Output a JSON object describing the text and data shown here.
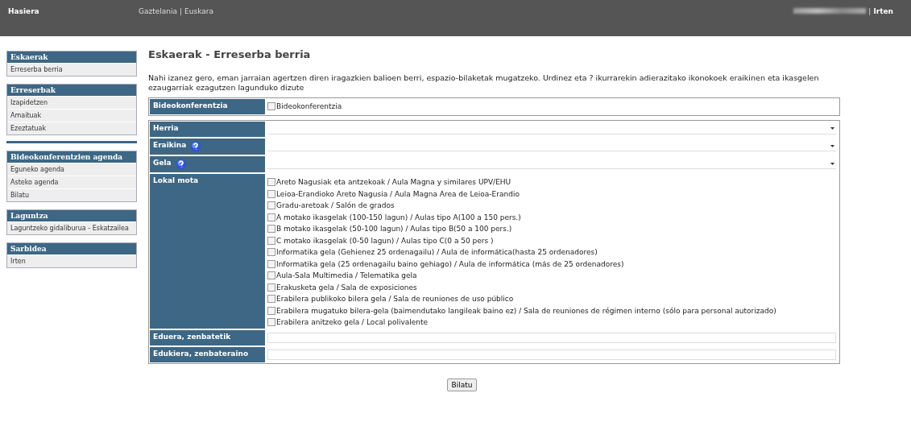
{
  "header": {
    "home": "Hasiera",
    "languages": [
      "Gaztelania",
      "Euskara"
    ],
    "separator": "|",
    "user_redacted": true,
    "logout": "Irten"
  },
  "sidebar": {
    "sections": [
      {
        "title": "Eskaerak",
        "items": [
          "Erreserba berria"
        ]
      },
      {
        "title": "Erreserbak",
        "items": [
          "Izapidetzen",
          "Amaituak",
          "Ezeztatuak"
        ],
        "divider_after": true
      },
      {
        "title": "Bideokonferentzien agenda",
        "items": [
          "Eguneko agenda",
          "Asteko agenda",
          "Bilatu"
        ]
      },
      {
        "title": "Laguntza",
        "items": [
          "Laguntzeko gidaliburua - Eskatzailea"
        ]
      },
      {
        "title": "Sarbidea",
        "items": [
          "Irten"
        ]
      }
    ]
  },
  "page_title": "Eskaerak - Erreserba berria",
  "description": "Nahi izanez gero, eman jarraian agertzen diren iragazkien balioen berri, espazio-bilaketak mugatzeko. Urdinez eta ? ikurrarekin adierazitako ikonokoek eraikinen eta ikasgelen ezaugarriak ezagutzen lagunduko dizute",
  "videoconference": {
    "label": "Bideokonferentzia",
    "option": {
      "label": "Bideokonferentzia",
      "checked": false
    }
  },
  "filters": [
    {
      "kind": "select",
      "label": "Herria",
      "help": false
    },
    {
      "kind": "select",
      "label": "Eraikina",
      "help": true
    },
    {
      "kind": "select",
      "label": "Gela",
      "help": true
    },
    {
      "kind": "checklist",
      "label": "Lokal mota",
      "options": [
        {
          "label": "Areto Nagusiak eta antzekoak / Aula Magna y similares UPV/EHU",
          "checked": false
        },
        {
          "label": "Leioa-Erandioko Areto Nagusia / Aula Magna Area de Leioa-Erandio",
          "checked": false
        },
        {
          "label": "Gradu-aretoak / Salón de grados",
          "checked": false
        },
        {
          "label": "A motako ikasgelak (100-150 lagun) / Aulas tipo A(100 a 150 pers.)",
          "checked": false
        },
        {
          "label": "B motako ikasgelak (50-100 lagun) / Aulas tipo B(50 a 100 pers.)",
          "checked": false
        },
        {
          "label": "C motako ikasgelak (0-50 lagun) / Aulas tipo C(0 a 50 pers )",
          "checked": false
        },
        {
          "label": "Informatika gela (Gehienez 25 ordenagailu) / Aula de informática(hasta 25 ordenadores)",
          "checked": false
        },
        {
          "label": "Informatika gela (25 ordenagailu baino gehiago) / Aula de informática (más de 25 ordenadores)",
          "checked": false
        },
        {
          "label": "Aula-Sala Multimedia / Telematika gela",
          "checked": false
        },
        {
          "label": "Erakusketa gela / Sala de exposiciones",
          "checked": false
        },
        {
          "label": "Erabilera publikoko bilera gela / Sala de reuniones de uso público",
          "checked": false
        },
        {
          "label": "Erabilera mugatuko bilera-gela (baimendutako langileak baino ez) / Sala de reuniones de régimen interno (sólo para personal autorizado)",
          "checked": false
        },
        {
          "label": "Erabilera anitzeko gela / Local polivalente",
          "checked": false
        }
      ]
    },
    {
      "kind": "text",
      "label": "Eduera, zenbatetik",
      "help": false
    },
    {
      "kind": "text",
      "label": "Edukiera, zenbateraino",
      "help": false
    }
  ],
  "search_button": "Bilatu"
}
